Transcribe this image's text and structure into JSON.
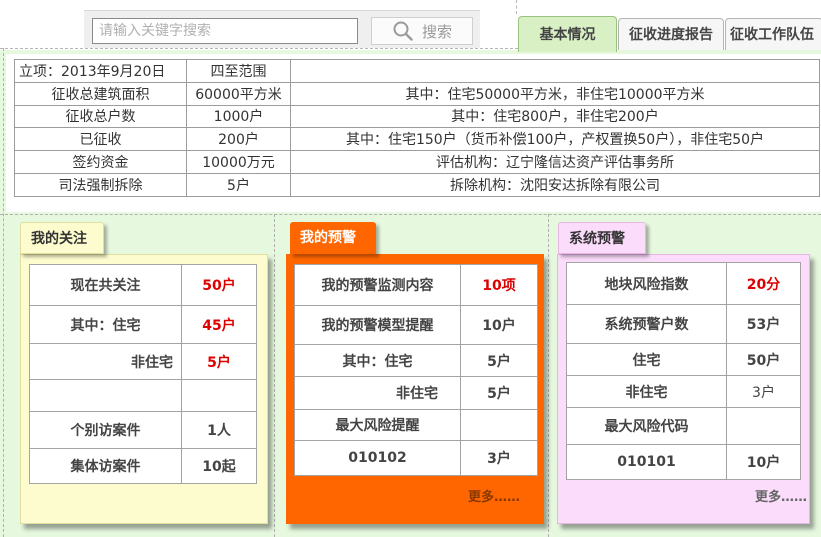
{
  "search": {
    "placeholder": "请输入关键字搜索",
    "button_label": "搜索",
    "icon": "search-icon"
  },
  "tabs": [
    {
      "label": "基本情况",
      "active": true
    },
    {
      "label": "征收进度报告",
      "active": false
    },
    {
      "label": "征收工作队伍",
      "active": false
    }
  ],
  "info_table": {
    "rows": [
      [
        "立项：2013年9月20日",
        "四至范围",
        ""
      ],
      [
        "征收总建筑面积",
        "60000平方米",
        "其中：住宅50000平方米，非住宅10000平方米"
      ],
      [
        "征收总户数",
        "1000户",
        "其中：住宅800户，非住宅200户"
      ],
      [
        "已征收",
        "200户",
        "其中：住宅150户（货币补偿100户，产权置换50户），非住宅50户"
      ],
      [
        "签约资金",
        "10000万元",
        "评估机构：辽宁隆信达资产评估事务所"
      ],
      [
        "司法强制拆除",
        "5户",
        "拆除机构：沈阳安达拆除有限公司"
      ]
    ]
  },
  "panels": {
    "follow": {
      "title": "我的关注",
      "rows": [
        {
          "label": "现在共关注",
          "value": "50户"
        },
        {
          "label": "其中：住宅",
          "value": "45户"
        },
        {
          "label": "非住宅",
          "value": "5户"
        },
        {
          "label": "",
          "value": ""
        },
        {
          "label": "个别访案件",
          "value": "1人"
        },
        {
          "label": "集体访案件",
          "value": "10起"
        }
      ]
    },
    "mywarn": {
      "title": "我的预警",
      "rows": [
        {
          "label": "我的预警监测内容",
          "value": "10项"
        },
        {
          "label": "我的预警模型提醒",
          "value": "10户"
        },
        {
          "label": "其中：住宅",
          "value": "5户"
        },
        {
          "label": "非住宅",
          "value": "5户"
        },
        {
          "label": "最大风险提醒",
          "value": ""
        },
        {
          "label": "010102",
          "value": "3户"
        }
      ],
      "more": "更多……"
    },
    "syswarn": {
      "title": "系统预警",
      "rows": [
        {
          "label": "地块风险指数",
          "value": "20分"
        },
        {
          "label": "系统预警户数",
          "value": "53户"
        },
        {
          "label": "住宅",
          "value": "50户"
        },
        {
          "label": "非住宅",
          "value": "3户"
        },
        {
          "label": "最大风险代码",
          "value": ""
        },
        {
          "label": "010101",
          "value": "10户"
        }
      ],
      "more": "更多……"
    }
  },
  "colors": {
    "page_bg": "#e6f8de",
    "accent_red": "#dd0000",
    "mywarn_orange": "#ff6600",
    "follow_yellow": "#fdfccf",
    "syswarn_pink": "#fbdcfb",
    "active_tab": "#d8f0c4"
  }
}
